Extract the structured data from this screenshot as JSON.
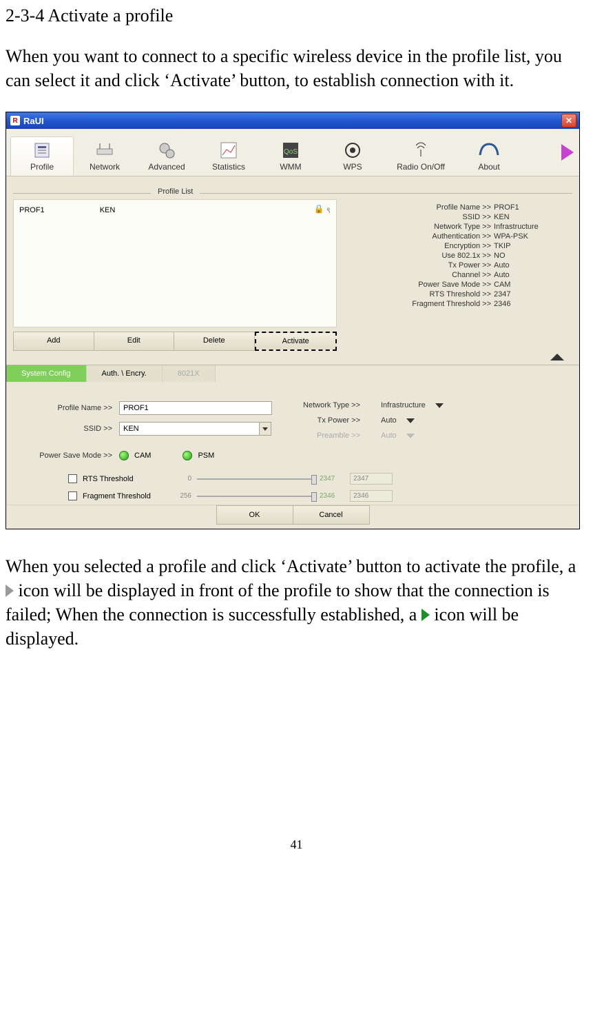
{
  "doc": {
    "heading": "2-3-4 Activate a profile",
    "para1": "When you want to connect to a specific wireless device in the profile list, you can select it and click ‘Activate’ button, to establish connection with it.",
    "para2_a": "When you selected a profile and click ‘Activate’ button to activate the profile, a ",
    "para2_b": " icon will be displayed in front of the profile to show that the connection is failed; When the connection is successfully established, a ",
    "para2_c": " icon will be displayed.",
    "page_number": "41"
  },
  "titlebar": {
    "app": "RaUI"
  },
  "toolbar": {
    "items": [
      {
        "label": "Profile"
      },
      {
        "label": "Network"
      },
      {
        "label": "Advanced"
      },
      {
        "label": "Statistics"
      },
      {
        "label": "WMM"
      },
      {
        "label": "WPS"
      },
      {
        "label": "Radio On/Off"
      },
      {
        "label": "About"
      }
    ]
  },
  "profile_list": {
    "legend": "Profile List",
    "row": {
      "name": "PROF1",
      "ssid": "KEN"
    },
    "buttons": {
      "add": "Add",
      "edit": "Edit",
      "delete": "Delete",
      "activate": "Activate"
    }
  },
  "details": {
    "rows": [
      {
        "k": "Profile Name >>",
        "v": "PROF1"
      },
      {
        "k": "SSID >>",
        "v": "KEN"
      },
      {
        "k": "Network Type >>",
        "v": "Infrastructure"
      },
      {
        "k": "Authentication >>",
        "v": "WPA-PSK"
      },
      {
        "k": "Encryption >>",
        "v": "TKIP"
      },
      {
        "k": "Use 802.1x >>",
        "v": "NO"
      },
      {
        "k": "Tx Power >>",
        "v": "Auto"
      },
      {
        "k": "Channel >>",
        "v": "Auto"
      },
      {
        "k": "Power Save Mode >>",
        "v": "CAM"
      },
      {
        "k": "RTS Threshold >>",
        "v": "2347"
      },
      {
        "k": "Fragment Threshold >>",
        "v": "2346"
      }
    ]
  },
  "config": {
    "tabs": {
      "sys": "System Config",
      "auth": "Auth. \\ Encry.",
      "dot1x": "8021X"
    },
    "labels": {
      "profile_name": "Profile Name >>",
      "ssid": "SSID >>",
      "psm": "Power Save Mode >>",
      "network_type": "Network Type >>",
      "tx_power": "Tx Power >>",
      "preamble": "Preamble >>",
      "rts": "RTS Threshold",
      "frag": "Fragment Threshold"
    },
    "values": {
      "profile_name": "PROF1",
      "ssid": "KEN",
      "cam": "CAM",
      "psm": "PSM",
      "network_type": "Infrastructure",
      "tx_power": "Auto",
      "preamble": "Auto",
      "rts_min": "0",
      "rts_max": "2347",
      "rts_val": "2347",
      "frag_min": "256",
      "frag_max": "2346",
      "frag_val": "2346"
    },
    "buttons": {
      "ok": "OK",
      "cancel": "Cancel"
    }
  }
}
